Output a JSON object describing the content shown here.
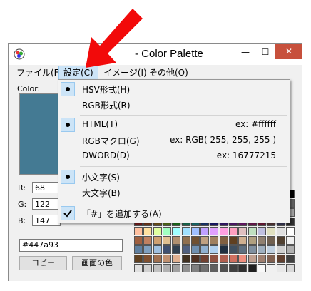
{
  "window": {
    "title": "- Color Palette",
    "minimize": "—",
    "maximize": "☐",
    "close": "✕"
  },
  "menu": {
    "file": "ファイル(F)",
    "settings": "設定(C)",
    "image": "イメージ(I)",
    "other": "その他(O)"
  },
  "panel": {
    "color_label": "Color:",
    "swatch_color": "#447a93",
    "r_label": "R:",
    "r_value": "68",
    "g_label": "G:",
    "g_value": "122",
    "b_label": "B:",
    "b_value": "147",
    "hex_value": "#447a93",
    "copy_button": "コピー",
    "screen_color_button": "画面の色"
  },
  "dropdown": {
    "items": [
      {
        "label": "HSV形式(H)",
        "checked": true,
        "check": "●"
      },
      {
        "label": "RGB形式(R)",
        "checked": false
      },
      {
        "label": "HTML(T)",
        "checked": true,
        "check": "●",
        "example": "ex: #ffffff"
      },
      {
        "label": "RGBマクロ(G)",
        "checked": false,
        "example": "ex: RGB( 255, 255, 255 )"
      },
      {
        "label": "DWORD(D)",
        "checked": false,
        "example": "ex: 16777215"
      },
      {
        "label": "小文字(S)",
        "checked": true,
        "check": "●"
      },
      {
        "label": "大文字(B)",
        "checked": false
      },
      {
        "label": "「#」を追加する(A)",
        "checked": true,
        "check": "✔"
      }
    ]
  },
  "colors": {
    "arrow": "#f20a0a",
    "menu_highlight": "#cce4f7",
    "close_button": "#c7503c"
  }
}
